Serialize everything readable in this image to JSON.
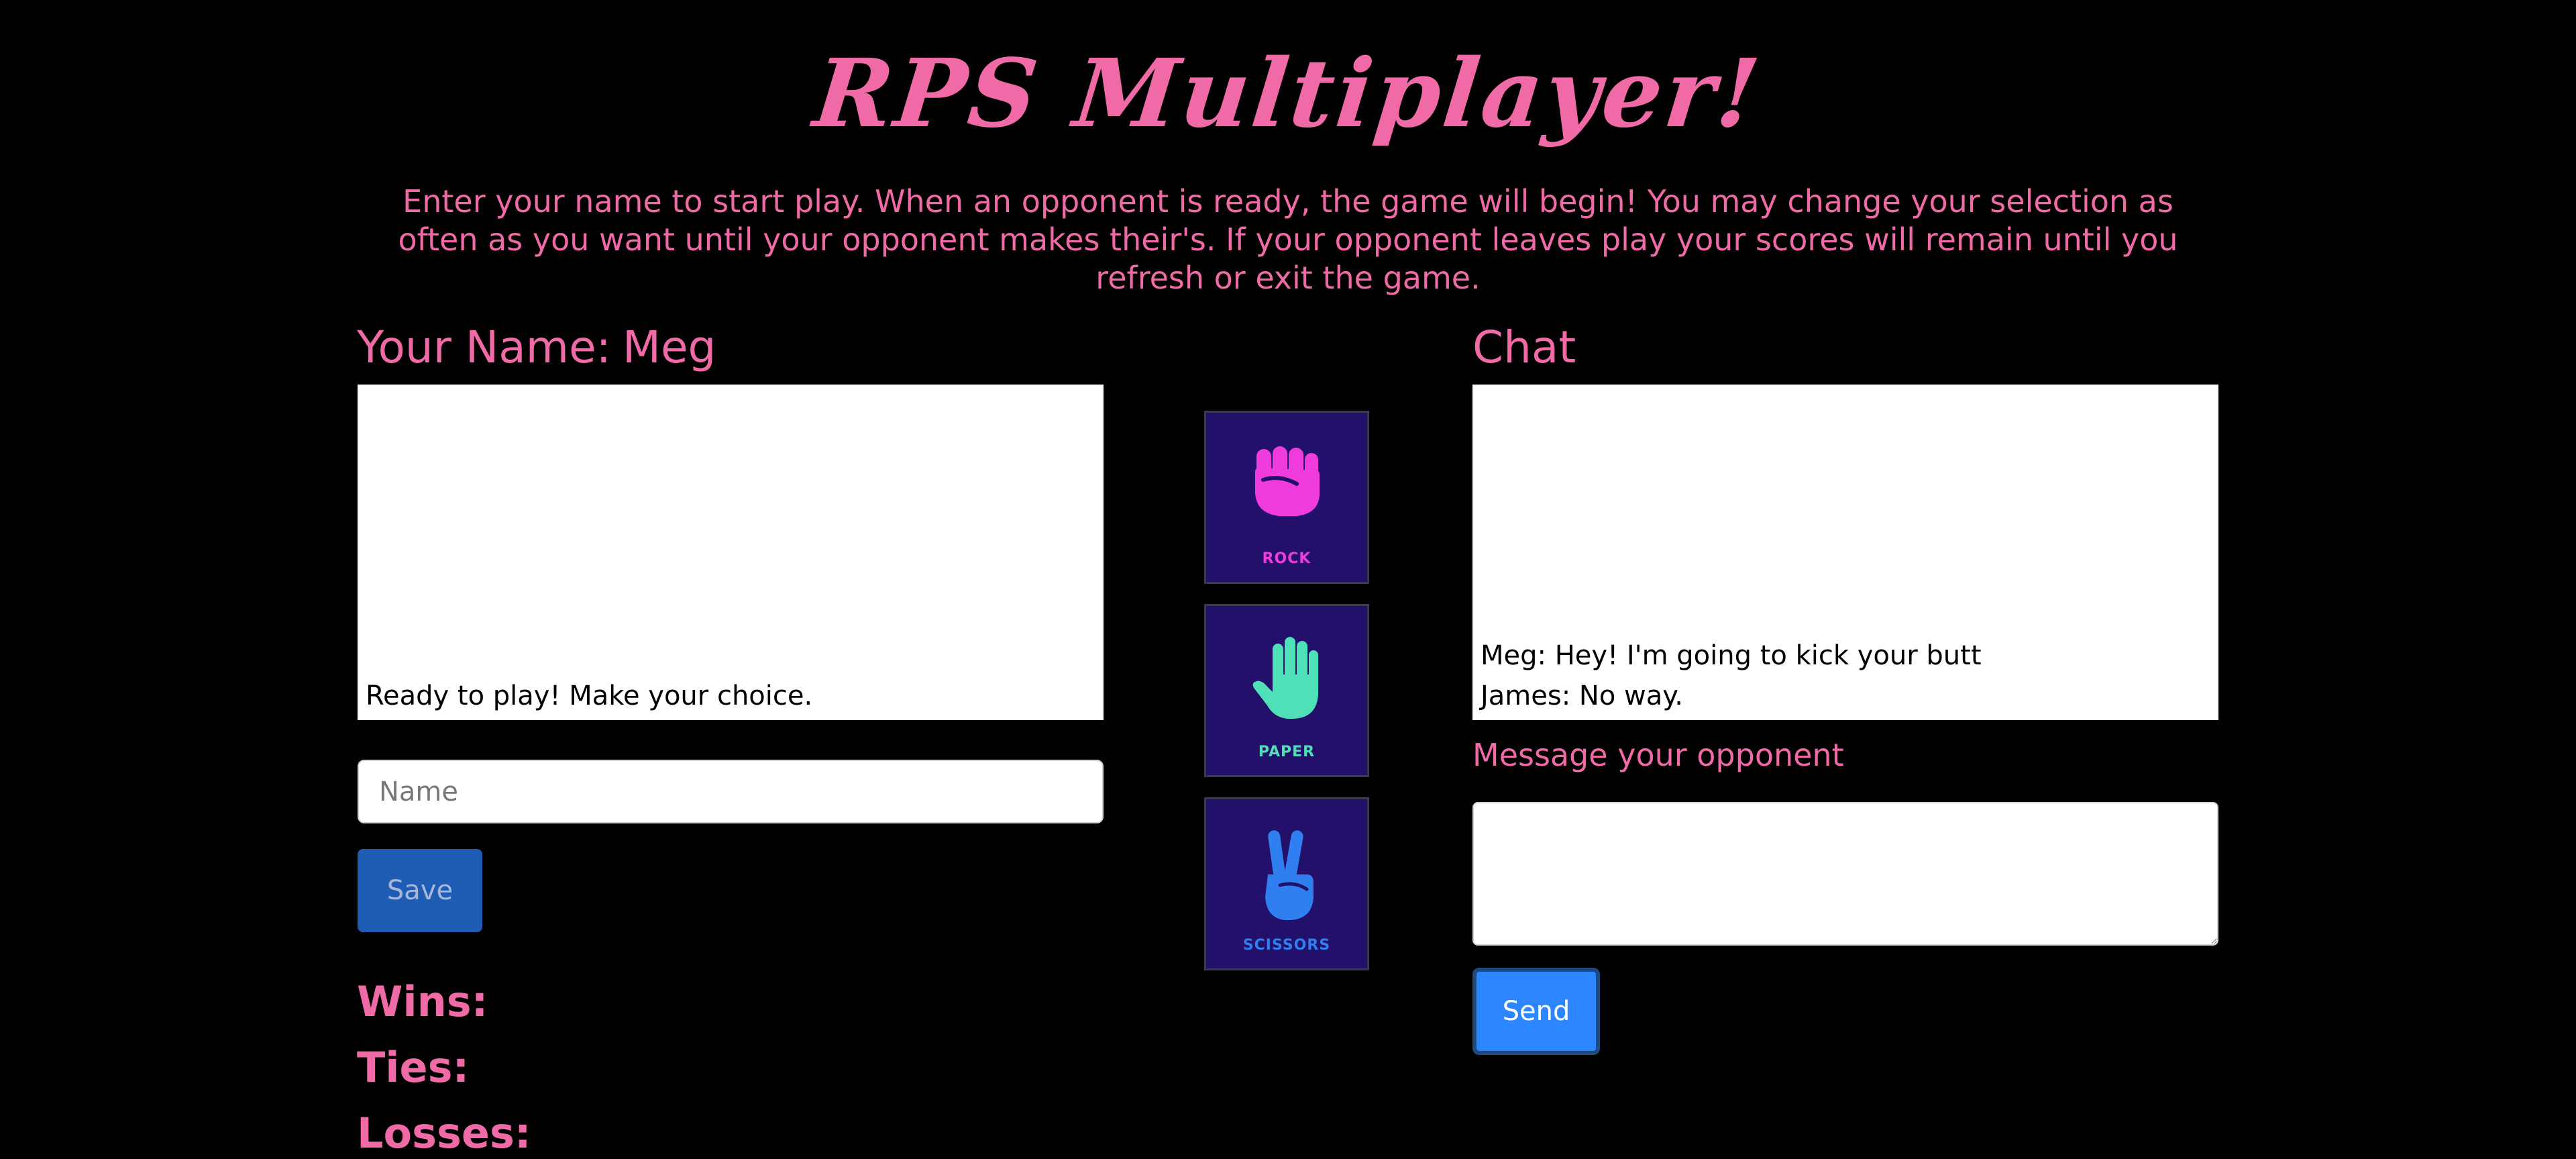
{
  "header": {
    "title": "RPS Multiplayer!",
    "intro": "Enter your name to start play. When an opponent is ready, the game will begin! You may change your selection as often as you want until your opponent makes their's. If your opponent leaves play your scores will remain until you refresh or exit the game."
  },
  "player": {
    "name_label": "Your Name:",
    "name_value": "Meg",
    "status_messages": [
      "Ready to play! Make your choice."
    ],
    "name_placeholder": "Name",
    "save_label": "Save",
    "wins_label": "Wins:",
    "ties_label": "Ties:",
    "losses_label": "Losses:"
  },
  "choices": [
    {
      "label": "ROCK",
      "icon": "fist-icon",
      "color": "#f03cdc"
    },
    {
      "label": "PAPER",
      "icon": "hand-icon",
      "color": "#4fe0b8"
    },
    {
      "label": "SCISSORS",
      "icon": "peace-hand-icon",
      "color": "#2f7ff0"
    }
  ],
  "chat": {
    "heading": "Chat",
    "messages": [
      "Meg: Hey! I'm going to kick your butt",
      "James: No way."
    ],
    "message_label": "Message your opponent",
    "send_label": "Send"
  },
  "colors": {
    "accent": "#f06aa8",
    "background": "#000000",
    "card": "#22106a",
    "send": "#2b86ff",
    "save": "#1f5cb4"
  }
}
